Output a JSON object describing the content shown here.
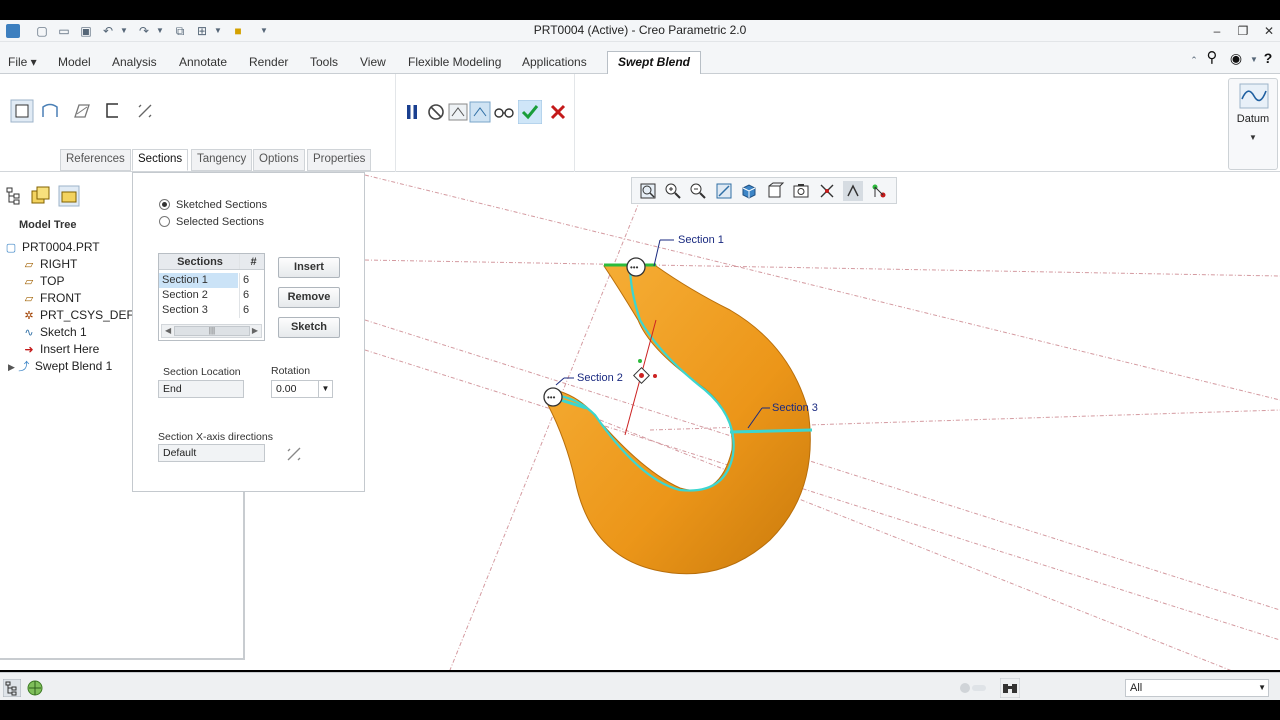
{
  "window": {
    "title": "PRT0004 (Active) - Creo Parametric 2.0"
  },
  "menu": {
    "file": "File",
    "tabs": [
      "Model",
      "Analysis",
      "Annotate",
      "Render",
      "Tools",
      "View",
      "Flexible Modeling",
      "Applications"
    ],
    "active_tab": "Swept Blend"
  },
  "ribbon": {
    "subtabs": [
      "References",
      "Sections",
      "Tangency",
      "Options",
      "Properties"
    ],
    "active_subtab": "Sections",
    "datum_label": "Datum"
  },
  "model_tree": {
    "title": "Model Tree",
    "items": [
      {
        "label": "PRT0004.PRT",
        "icon": "part-icon"
      },
      {
        "label": "RIGHT",
        "icon": "datum-plane-icon"
      },
      {
        "label": "TOP",
        "icon": "datum-plane-icon"
      },
      {
        "label": "FRONT",
        "icon": "datum-plane-icon"
      },
      {
        "label": "PRT_CSYS_DEF",
        "icon": "csys-icon"
      },
      {
        "label": "Sketch 1",
        "icon": "sketch-icon"
      },
      {
        "label": "Insert Here",
        "icon": "insert-arrow-icon"
      },
      {
        "label": "Swept Blend 1",
        "icon": "swept-blend-icon"
      }
    ]
  },
  "sections_panel": {
    "radio_sketched": "Sketched Sections",
    "radio_selected": "Selected Sections",
    "selected_mode": "sketched",
    "table": {
      "headers": [
        "Sections",
        "#"
      ],
      "rows": [
        {
          "name": "Section 1",
          "count": "6",
          "selected": true
        },
        {
          "name": "Section 2",
          "count": "6",
          "selected": false
        },
        {
          "name": "Section 3",
          "count": "6",
          "selected": false
        }
      ]
    },
    "buttons": {
      "insert": "Insert",
      "remove": "Remove",
      "sketch": "Sketch"
    },
    "section_location_label": "Section Location",
    "section_location_value": "End",
    "rotation_label": "Rotation",
    "rotation_value": "0.00",
    "xaxis_label": "Section X-axis directions",
    "xaxis_value": "Default"
  },
  "viewport": {
    "labels": {
      "section1": "Section 1",
      "section2": "Section 2",
      "section3": "Section 3"
    },
    "model_color": "#f39c12",
    "trajectory_color": "#3cd6d0",
    "datum_line_color": "#d49aa0"
  },
  "status": {
    "filter_value": "All"
  },
  "colors": {
    "accent_confirm": "#1a9e3a",
    "accent_cancel": "#c41a1a",
    "selection": "#cbe3f7"
  }
}
